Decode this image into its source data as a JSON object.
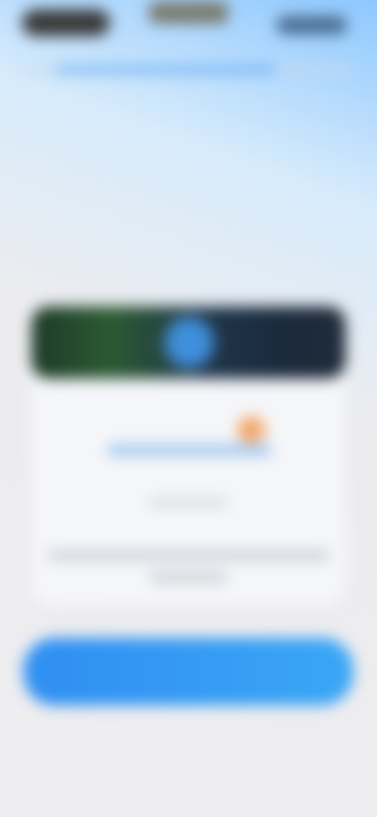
{
  "status_bar": {
    "left_icon": "time-pill",
    "center_icon": "camera-cutout",
    "right_icon": "status-indicators"
  },
  "progress": {
    "value": 0.7
  },
  "colors": {
    "accent": "#3a9bf4",
    "badge": "#f4a76a",
    "map_dark": "#1b2a3d",
    "location_dot": "#3e8fdc"
  },
  "icons": {
    "map": "map-banner-icon",
    "location": "location-dot-icon"
  }
}
